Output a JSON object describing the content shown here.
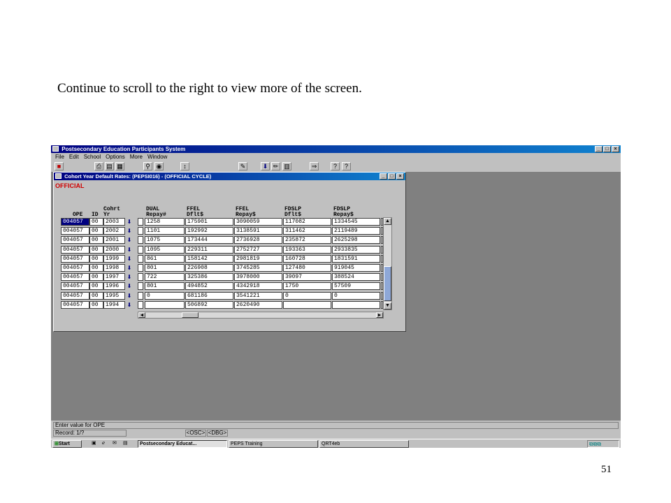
{
  "caption": "Continue to scroll to the right to view more of the screen.",
  "page_number": "51",
  "app": {
    "title": "Postsecondary Education Participants System",
    "menu": [
      "File",
      "Edit",
      "School",
      "Options",
      "More",
      "Window"
    ],
    "toolbar_icons": [
      "exit-icon",
      "print-icon",
      "preview-icon",
      "save-icon",
      "find-icon",
      "clear-icon",
      "insert-record-icon",
      "delete-record-icon",
      "info-icon",
      "calculator-icon",
      "next-block-icon",
      "edit-icon",
      "list-icon",
      "keys-icon",
      "help-icon",
      "question-icon"
    ]
  },
  "form": {
    "title": "Cohort Year Default Rates: (PEPSI016) - (OFFICIAL CYCLE)",
    "label": "OFFICIAL",
    "headers": [
      {
        "top": "",
        "bottom": "OPE"
      },
      {
        "top": "",
        "bottom": "ID"
      },
      {
        "top": "Cohrt",
        "bottom": "Yr"
      },
      {
        "top": "DUAL",
        "bottom": "Repay#"
      },
      {
        "top": "FFEL",
        "bottom": "Dflt$"
      },
      {
        "top": "FFEL",
        "bottom": "Repay$"
      },
      {
        "top": "FDSLP",
        "bottom": "Dflt$"
      },
      {
        "top": "FDSLP",
        "bottom": "Repay$"
      }
    ],
    "rows": [
      [
        "004057",
        "00",
        "2003",
        "1258",
        "175901",
        "3090059",
        "117082",
        "1334545"
      ],
      [
        "004057",
        "00",
        "2002",
        "1101",
        "192992",
        "3138591",
        "311462",
        "2119489"
      ],
      [
        "004057",
        "00",
        "2001",
        "1075",
        "173444",
        "2736928",
        "235872",
        "2625298"
      ],
      [
        "004057",
        "00",
        "2000",
        "1095",
        "229311",
        "2752727",
        "193363",
        "2933835"
      ],
      [
        "004057",
        "00",
        "1999",
        "861",
        "158142",
        "2981819",
        "160728",
        "1831591"
      ],
      [
        "004057",
        "00",
        "1998",
        "801",
        "226908",
        "3745285",
        "127480",
        "919045"
      ],
      [
        "004057",
        "00",
        "1997",
        "722",
        "325386",
        "3978000",
        "39097",
        "388524"
      ],
      [
        "004057",
        "00",
        "1996",
        "801",
        "494852",
        "4342918",
        "1750",
        "57509"
      ],
      [
        "004057",
        "00",
        "1995",
        "0",
        "681186",
        "3541221",
        "0",
        "0"
      ],
      [
        "004057",
        "00",
        "1994",
        "",
        "506892",
        "2620490",
        "",
        ""
      ]
    ]
  },
  "status": {
    "line1": "Enter value for  OPE",
    "record": "Record: 1/?",
    "osc": "<OSC>",
    "dbg": "<DBG>"
  },
  "taskbar": {
    "start": "Start",
    "items": [
      "Postsecondary Educat...",
      "PEPS Training",
      "QRT4eb"
    ]
  }
}
